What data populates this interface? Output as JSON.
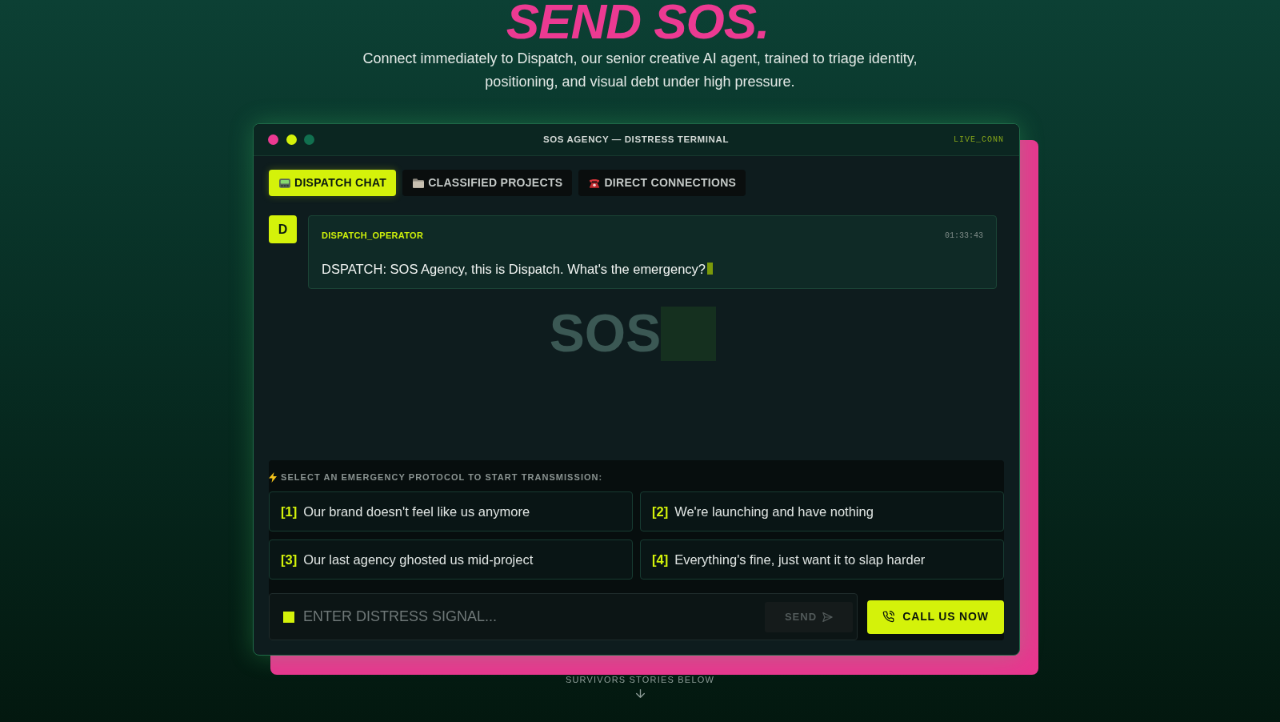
{
  "hero": {
    "title": "SEND SOS.",
    "subtitle": "Connect immediately to Dispatch, our senior creative AI agent, trained to triage identity, positioning, and visual debt under high pressure."
  },
  "terminal": {
    "title": "SOS AGENCY — DISTRESS TERMINAL",
    "status": "LIVE_CONN",
    "tabs": [
      {
        "label": "DISPATCH CHAT",
        "selected": true
      },
      {
        "label": "CLASSIFIED PROJECTS",
        "selected": false
      },
      {
        "label": "DIRECT CONNECTIONS",
        "selected": false
      }
    ],
    "messages": [
      {
        "avatar": "D",
        "author": "DISPATCH_OPERATOR",
        "time": "01:33:43",
        "text": "DSPATCH: SOS Agency, this is Dispatch. What's the emergency?",
        "typing": true
      }
    ],
    "logo": "SOS",
    "protocol_prompt": "SELECT AN EMERGENCY PROTOCOL TO START TRANSMISSION:",
    "protocols": [
      {
        "number": "[1]",
        "text": "Our brand doesn't feel like us anymore"
      },
      {
        "number": "[2]",
        "text": "We're launching and have nothing"
      },
      {
        "number": "[3]",
        "text": "Our last agency ghosted us mid-project"
      },
      {
        "number": "[4]",
        "text": "Everything's fine, just want it to slap harder"
      }
    ],
    "input": {
      "placeholder": "ENTER DISTRESS SIGNAL..."
    },
    "send_button": {
      "label": "SEND",
      "disabled": true
    },
    "call_button": {
      "label": "CALL US NOW"
    }
  },
  "scroll_hint": "SURVIVORS STORIES BELOW"
}
